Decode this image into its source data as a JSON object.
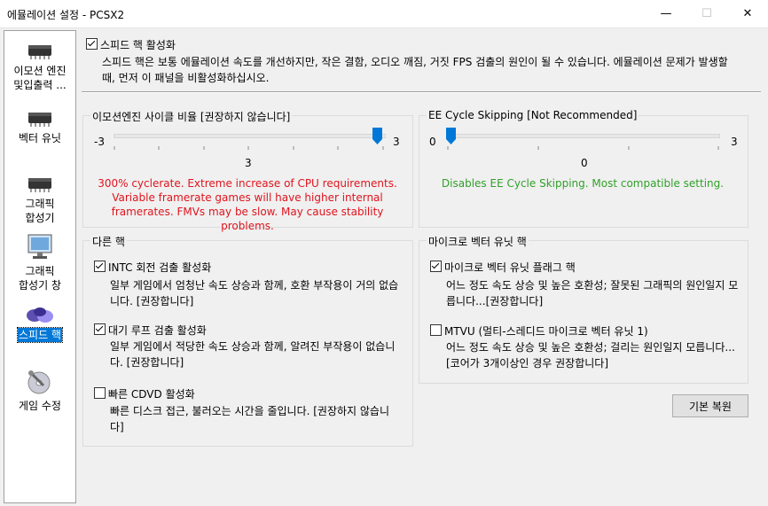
{
  "window": {
    "title": "에뮬레이션 설정 - PCSX2"
  },
  "sidebar": {
    "items": [
      {
        "line1": "이모션 엔진",
        "line2": "및입출력 ..."
      },
      {
        "line1": "벡터 유닛",
        "line2": ""
      },
      {
        "line1": "그래픽",
        "line2": "합성기"
      },
      {
        "line1": "그래픽",
        "line2": "합성기 창"
      },
      {
        "line1": "스피드 핵",
        "line2": ""
      },
      {
        "line1": "게임 수정",
        "line2": ""
      }
    ]
  },
  "speedhacks": {
    "enable_label": "스피드 핵 활성화",
    "enable_checked": true,
    "description": "스피드 핵은 보통 에뮬레이션 속도를 개선하지만, 작은 결함, 오디오 깨짐, 거짓 FPS 검출의 원인이 될 수 있습니다. 에뮬레이션 문제가 발생할 때, 먼저 이 패널을 비활성화하십시오."
  },
  "ee_cyclerate": {
    "title": "이모션엔진 사이클 비율 [권장하지 않습니다]",
    "min": "-3",
    "max": "3",
    "value_label": "3",
    "value": 3,
    "warning": "300% cyclerate. Extreme increase of CPU requirements. Variable framerate games will have higher internal framerates. FMVs may be slow. May cause stability problems."
  },
  "ee_skipping": {
    "title": "EE Cycle Skipping [Not Recommended]",
    "min": "0",
    "max": "3",
    "value_label": "0",
    "value": 0,
    "info": "Disables EE Cycle Skipping. Most compatible setting."
  },
  "other_hacks": {
    "title": "다른 핵",
    "intc_label": "INTC 회전 검출 활성화",
    "intc_desc": "일부 게임에서 엄청난 속도 상승과 함께, 호환 부작용이 거의 없습니다. [권장합니다]",
    "wait_label": "대기 루프 검출 활성화",
    "wait_desc": "일부 게임에서 적당한 속도 상승과 함께, 알려진 부작용이 없습니다. [권장합니다]",
    "cdvd_label": "빠른 CDVD 활성화",
    "cdvd_desc": "빠른 디스크 접근, 불러오는 시간을 줄입니다. [권장하지 않습니다]"
  },
  "microvu_hacks": {
    "title": "마이크로 벡터 유닛 핵",
    "flag_label": "마이크로 벡터 유닛 플래그 핵",
    "flag_desc": "어느 정도 속도 상승 및 높은 호환성; 잘못된 그래픽의 원인일지 모릅니다...[권장합니다]",
    "mtvu_label": "MTVU (멀티-스레디드 마이크로 벡터 유닛 1)",
    "mtvu_desc": "어느 정도 속도 상승 및 높은 호환성; 걸리는 원인일지 모릅니다...[코어가 3개이상인 경우 권장합니다]"
  },
  "buttons": {
    "restore_defaults": "기본 복원"
  }
}
